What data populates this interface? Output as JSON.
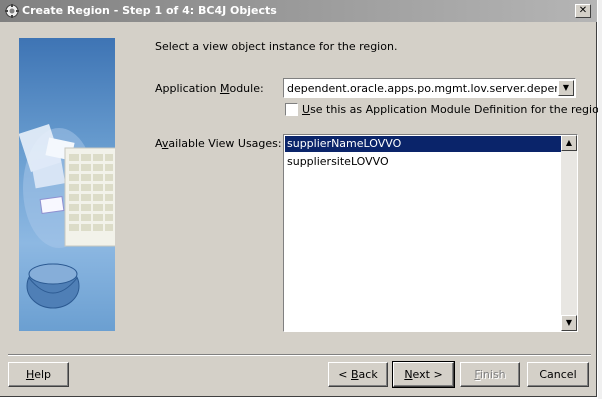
{
  "window": {
    "title": "Create Region - Step 1 of 4: BC4J Objects",
    "close_glyph": "✕"
  },
  "instruction": "Select a view object instance for the region.",
  "application_module": {
    "label_prefix": "Application ",
    "label_underlined": "M",
    "label_suffix": "odule:",
    "value": "dependent.oracle.apps.po.mgmt.lov.server.dependent..."
  },
  "checkbox": {
    "label_prefix": "",
    "label_underlined": "U",
    "label_suffix": "se this as Application Module Definition for the region",
    "checked": false
  },
  "view_usages": {
    "label_prefix": "A",
    "label_underlined": "v",
    "label_suffix": "ailable View Usages:",
    "items": [
      {
        "label": "supplierNameLOVVO",
        "selected": true
      },
      {
        "label": "suppliersiteLOVVO",
        "selected": false
      }
    ]
  },
  "buttons": {
    "help_u": "H",
    "help_rest": "elp",
    "back_pre": "< ",
    "back_u": "B",
    "back_rest": "ack",
    "next_u": "N",
    "next_rest": "ext >",
    "finish_u": "F",
    "finish_rest": "inish",
    "cancel": "Cancel"
  },
  "colors": {
    "selection": "#0a246a",
    "dialog_bg": "#d4d0c8",
    "side_panel": "#5b8fc7"
  }
}
